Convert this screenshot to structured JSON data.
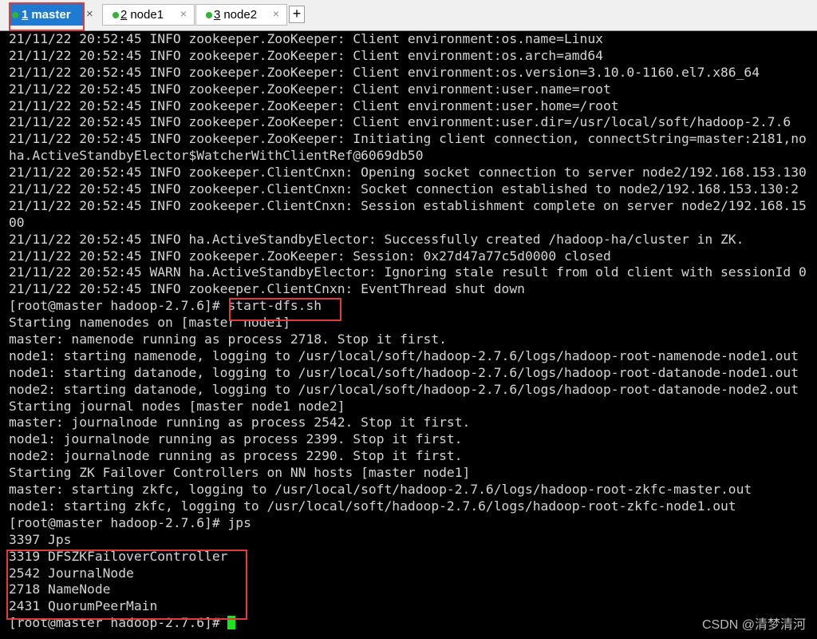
{
  "tabs": [
    {
      "number": "1",
      "name": "master",
      "close": "×"
    },
    {
      "number": "2",
      "name": "node1",
      "close": "×"
    },
    {
      "number": "3",
      "name": "node2",
      "close": "×"
    }
  ],
  "new_tab_label": "+",
  "status_color": "#2fb52f",
  "highlight_color": "#e23a3a",
  "terminal": {
    "lines": [
      "21/11/22 20:52:45 INFO zookeeper.ZooKeeper: Client environment:os.name=Linux",
      "21/11/22 20:52:45 INFO zookeeper.ZooKeeper: Client environment:os.arch=amd64",
      "21/11/22 20:52:45 INFO zookeeper.ZooKeeper: Client environment:os.version=3.10.0-1160.el7.x86_64",
      "21/11/22 20:52:45 INFO zookeeper.ZooKeeper: Client environment:user.name=root",
      "21/11/22 20:52:45 INFO zookeeper.ZooKeeper: Client environment:user.home=/root",
      "21/11/22 20:52:45 INFO zookeeper.ZooKeeper: Client environment:user.dir=/usr/local/soft/hadoop-2.7.6",
      "21/11/22 20:52:45 INFO zookeeper.ZooKeeper: Initiating client connection, connectString=master:2181,no",
      "ha.ActiveStandbyElector$WatcherWithClientRef@6069db50",
      "21/11/22 20:52:45 INFO zookeeper.ClientCnxn: Opening socket connection to server node2/192.168.153.130",
      "21/11/22 20:52:45 INFO zookeeper.ClientCnxn: Socket connection established to node2/192.168.153.130:2",
      "21/11/22 20:52:45 INFO zookeeper.ClientCnxn: Session establishment complete on server node2/192.168.15",
      "00",
      "21/11/22 20:52:45 INFO ha.ActiveStandbyElector: Successfully created /hadoop-ha/cluster in ZK.",
      "21/11/22 20:52:45 INFO zookeeper.ZooKeeper: Session: 0x27d47a77c5d0000 closed",
      "21/11/22 20:52:45 WARN ha.ActiveStandbyElector: Ignoring stale result from old client with sessionId 0",
      "21/11/22 20:52:45 INFO zookeeper.ClientCnxn: EventThread shut down",
      "[root@master hadoop-2.7.6]# start-dfs.sh",
      "Starting namenodes on [master node1]",
      "master: namenode running as process 2718. Stop it first.",
      "node1: starting namenode, logging to /usr/local/soft/hadoop-2.7.6/logs/hadoop-root-namenode-node1.out",
      "node1: starting datanode, logging to /usr/local/soft/hadoop-2.7.6/logs/hadoop-root-datanode-node1.out",
      "node2: starting datanode, logging to /usr/local/soft/hadoop-2.7.6/logs/hadoop-root-datanode-node2.out",
      "Starting journal nodes [master node1 node2]",
      "master: journalnode running as process 2542. Stop it first.",
      "node1: journalnode running as process 2399. Stop it first.",
      "node2: journalnode running as process 2290. Stop it first.",
      "Starting ZK Failover Controllers on NN hosts [master node1]",
      "master: starting zkfc, logging to /usr/local/soft/hadoop-2.7.6/logs/hadoop-root-zkfc-master.out",
      "node1: starting zkfc, logging to /usr/local/soft/hadoop-2.7.6/logs/hadoop-root-zkfc-node1.out",
      "[root@master hadoop-2.7.6]# jps",
      "3397 Jps",
      "3319 DFSZKFailoverController",
      "2542 JournalNode",
      "2718 NameNode",
      "2431 QuorumPeerMain"
    ],
    "prompt": "[root@master hadoop-2.7.6]# ",
    "cursor_color": "#19e619"
  },
  "watermark": "CSDN @清梦清河"
}
